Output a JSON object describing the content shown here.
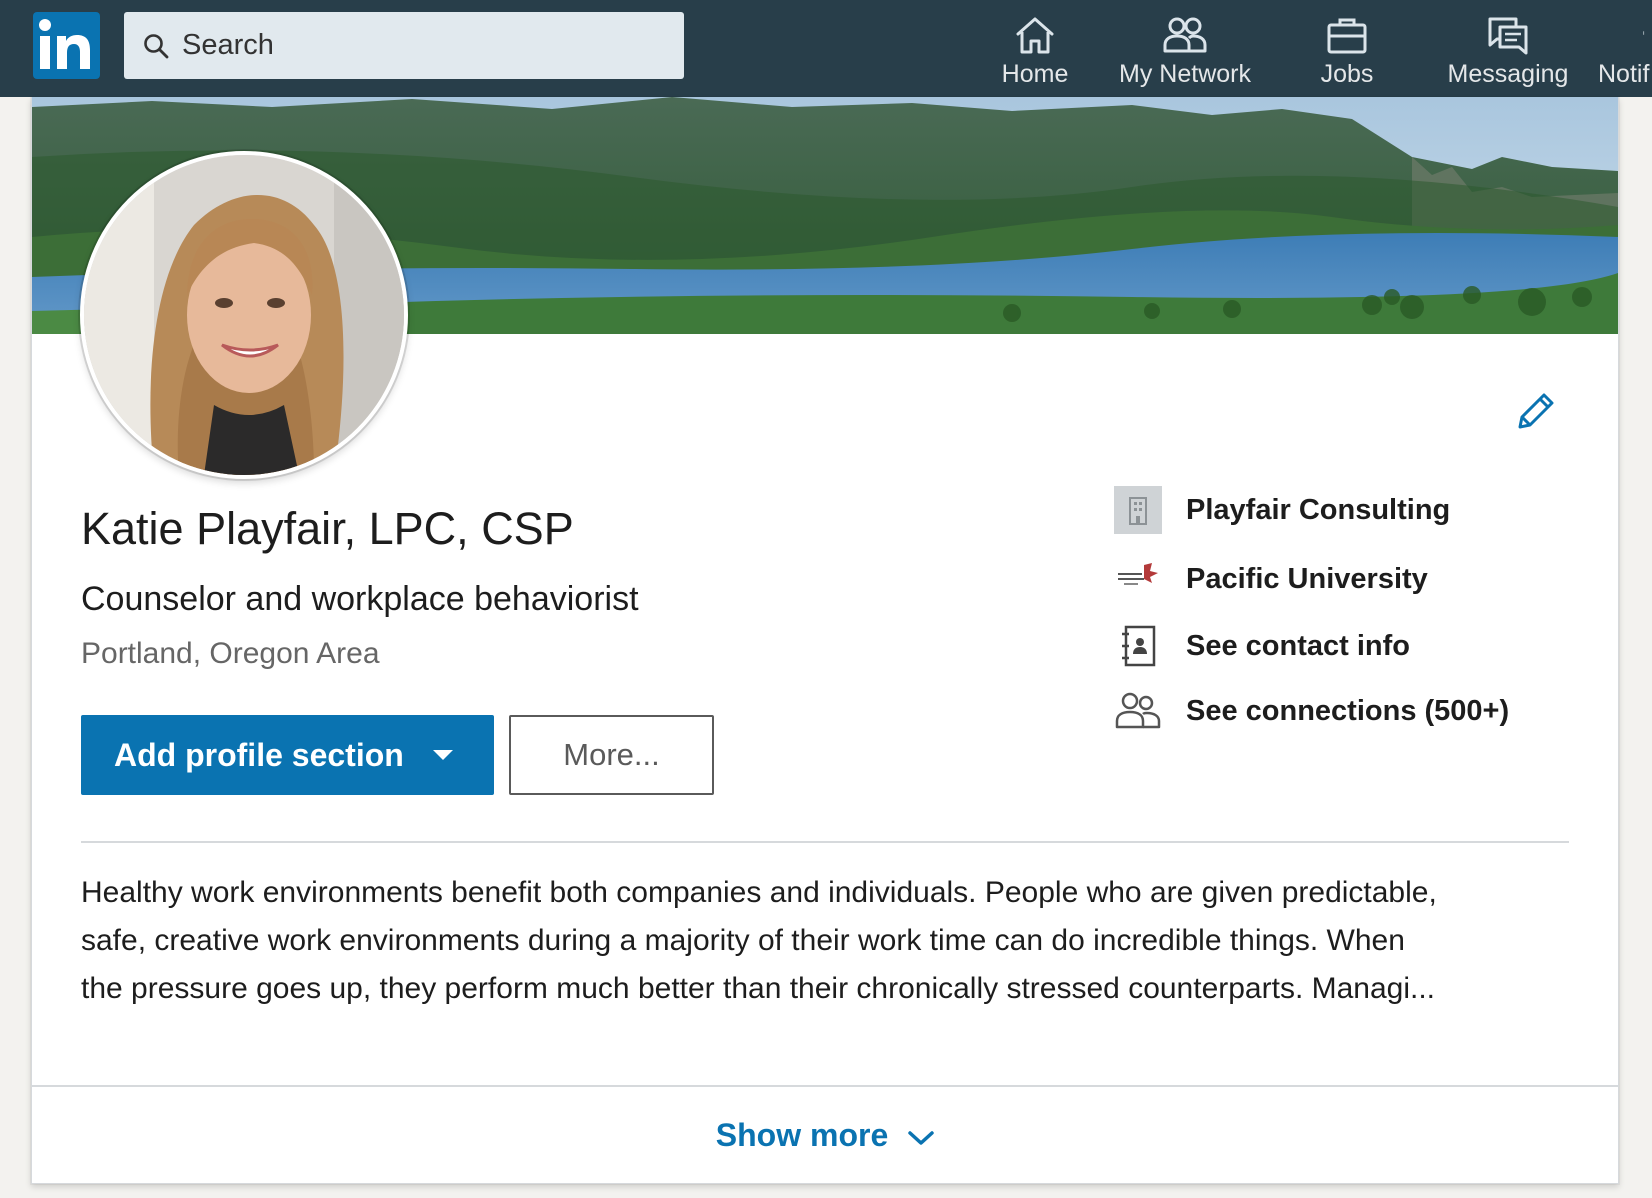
{
  "nav": {
    "logo_text": "in",
    "search_placeholder": "Search",
    "items": [
      {
        "label": "Home",
        "icon": "home-icon"
      },
      {
        "label": "My Network",
        "icon": "network-icon"
      },
      {
        "label": "Jobs",
        "icon": "briefcase-icon"
      },
      {
        "label": "Messaging",
        "icon": "messaging-icon"
      },
      {
        "label": "Notif",
        "icon": "bell-icon"
      }
    ]
  },
  "profile": {
    "name": "Katie Playfair, LPC, CSP",
    "headline": "Counselor and workplace behaviorist",
    "location": "Portland, Oregon Area",
    "add_section_label": "Add profile section",
    "more_label": "More...",
    "sidebar": [
      {
        "label": "Playfair Consulting",
        "icon": "company-building-icon"
      },
      {
        "label": "Pacific University",
        "icon": "university-logo-icon"
      },
      {
        "label": "See contact info",
        "icon": "contact-book-icon"
      },
      {
        "label": "See connections (500+)",
        "icon": "connections-icon"
      }
    ],
    "summary_lines": [
      "Healthy work environments benefit both companies and individuals. People who are given predictable,",
      "safe, creative work environments during a majority of their work time can do incredible things. When",
      "the pressure goes up, they perform much better than their chronically stressed counterparts. Managi..."
    ],
    "show_more_label": "Show more"
  },
  "colors": {
    "nav_bg": "#283e4a",
    "brand_blue": "#0a73b1",
    "search_bg": "#e1e9ee",
    "muted_text": "#666666"
  }
}
